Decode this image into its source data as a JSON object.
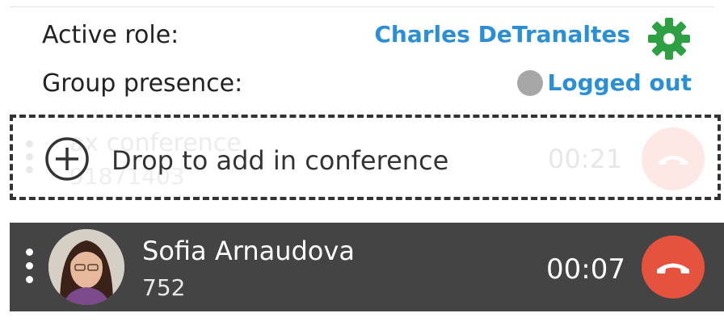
{
  "header": {
    "active_role_label": "Active role:",
    "active_role_value": "Charles DeTranaltes",
    "settings_icon": "gear-icon",
    "group_presence_label": "Group presence:",
    "group_presence_value": "Logged out",
    "presence_status_color": "#a7a7a7"
  },
  "conference_row": {
    "name": "ax conference",
    "number": "91871403",
    "timer": "00:21"
  },
  "drop_zone": {
    "icon": "plus-circle-icon",
    "text": "Drop to add in conference"
  },
  "active_call": {
    "name": "Sofia Arnaudova",
    "number": "752",
    "timer": "00:07",
    "hangup_icon": "hangup-icon"
  },
  "colors": {
    "link": "#2b8fd6",
    "gear": "#2ea043",
    "hangup": "#e5533f",
    "call_row_bg": "#444444"
  }
}
